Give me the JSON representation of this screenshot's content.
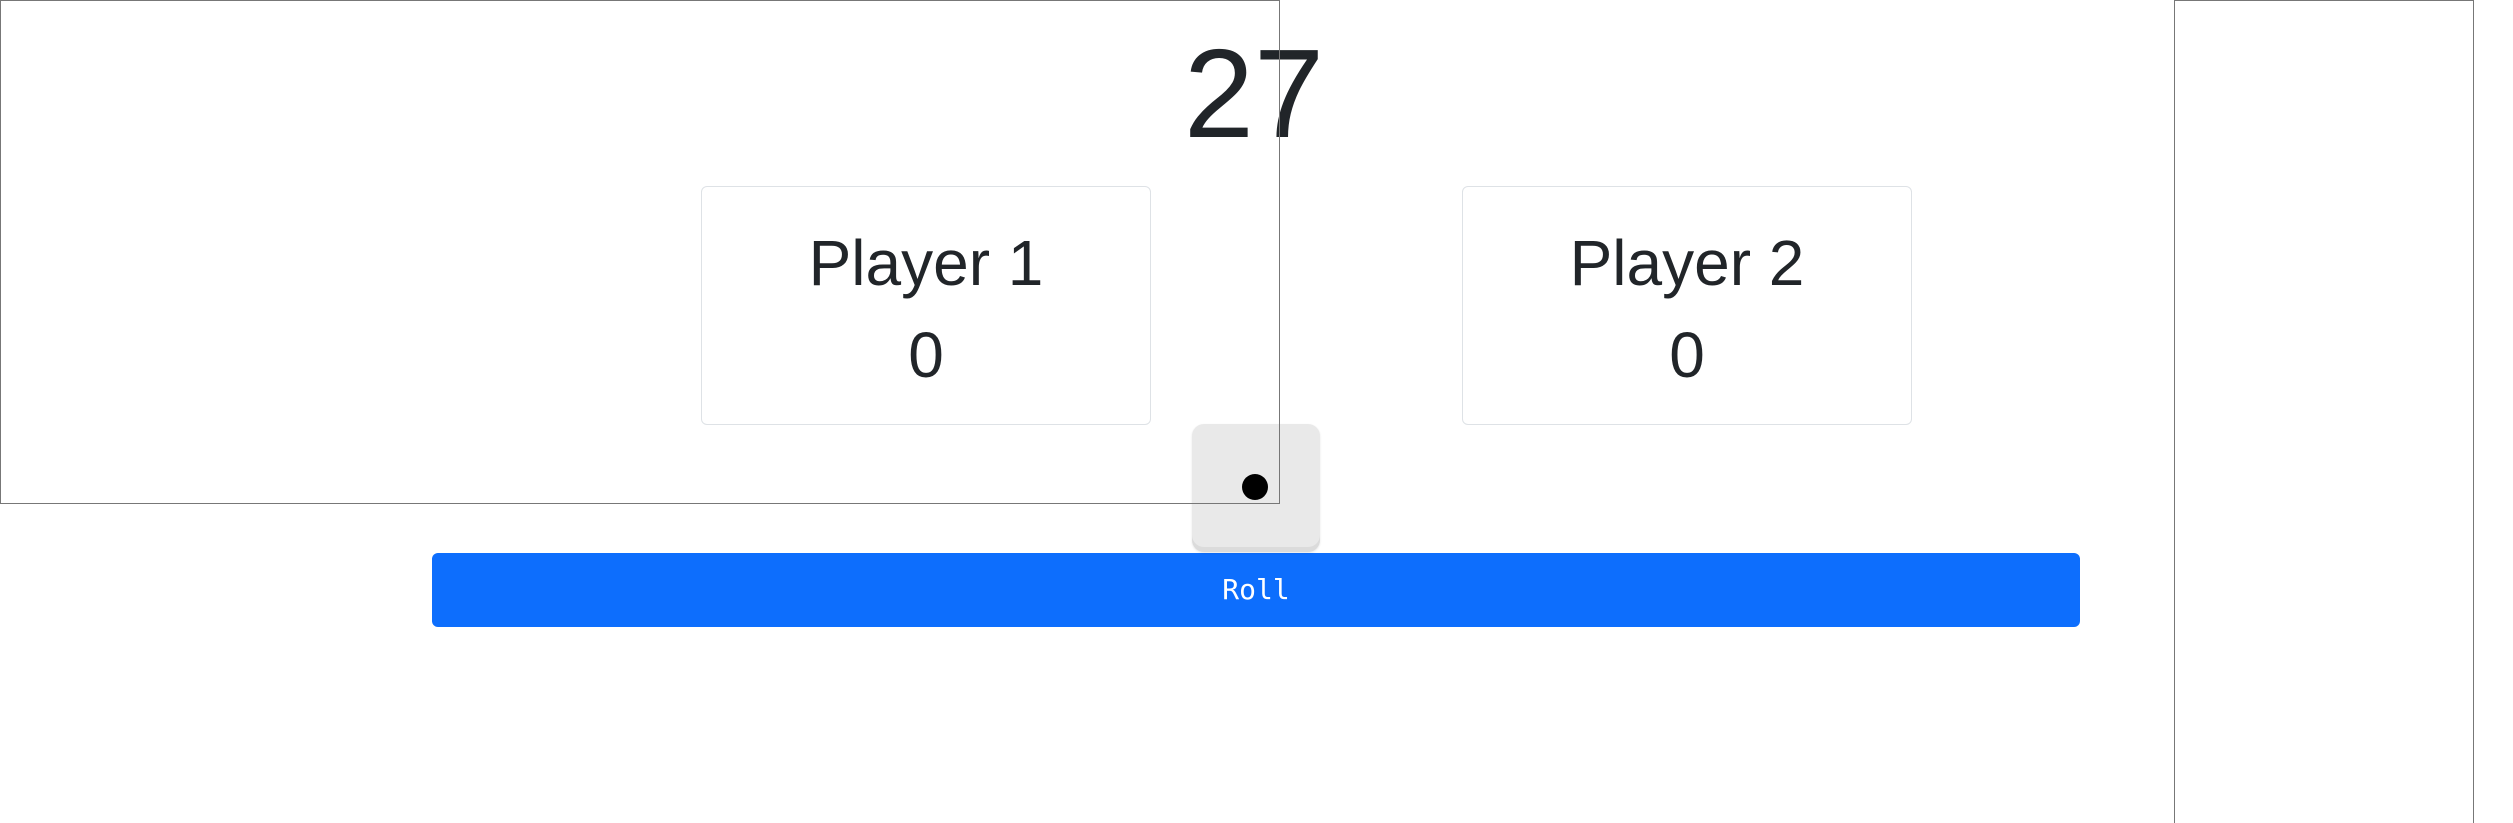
{
  "game": {
    "target_score": "27",
    "players": [
      {
        "name": "Player 1",
        "score": "0"
      },
      {
        "name": "Player 2",
        "score": "0"
      }
    ],
    "die": {
      "face": 1,
      "icon": "die-face-one-icon"
    },
    "roll_label": "Roll"
  },
  "colors": {
    "primary": "#0d6efd",
    "text": "#212529",
    "card_border": "#dee2e6",
    "die_face": "#e9e9e9",
    "pip": "#000000"
  }
}
